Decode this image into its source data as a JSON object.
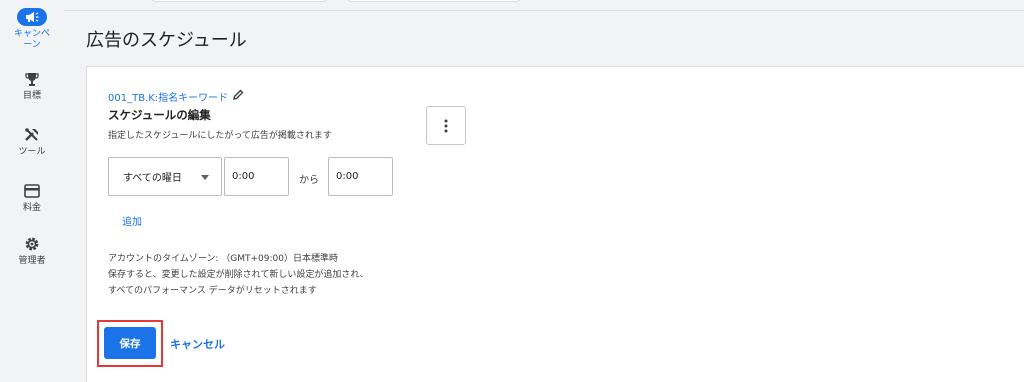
{
  "nav": {
    "items": [
      {
        "label": "キャンペーン",
        "icon": "megaphone-icon",
        "active": true
      },
      {
        "label": "目標",
        "icon": "trophy-icon"
      },
      {
        "label": "ツール",
        "icon": "tools-icon"
      },
      {
        "label": "料金",
        "icon": "credit-card-icon"
      },
      {
        "label": "管理者",
        "icon": "gear-icon"
      }
    ]
  },
  "page": {
    "title": "広告のスケジュール"
  },
  "schedule": {
    "campaign_name": "001_TB.K:指名キーワード",
    "section_title": "スケジュールの編集",
    "description": "指定したスケジュールにしたがって広告が掲載されます",
    "day_select_value": "すべての曜日",
    "start_time": "0:00",
    "from_label": "から",
    "end_time": "0:00",
    "add_label": "追加",
    "timezone_note": "アカウントのタイムゾーン: （GMT+09:00）日本標準時",
    "warning_line1": "保存すると、変更した設定が削除されて新しい設定が追加され、",
    "warning_line2": "すべてのパフォーマンス データがリセットされます",
    "save_label": "保存",
    "cancel_label": "キャンセル"
  },
  "colors": {
    "accent": "#1a73e8",
    "highlight": "#e53935"
  }
}
